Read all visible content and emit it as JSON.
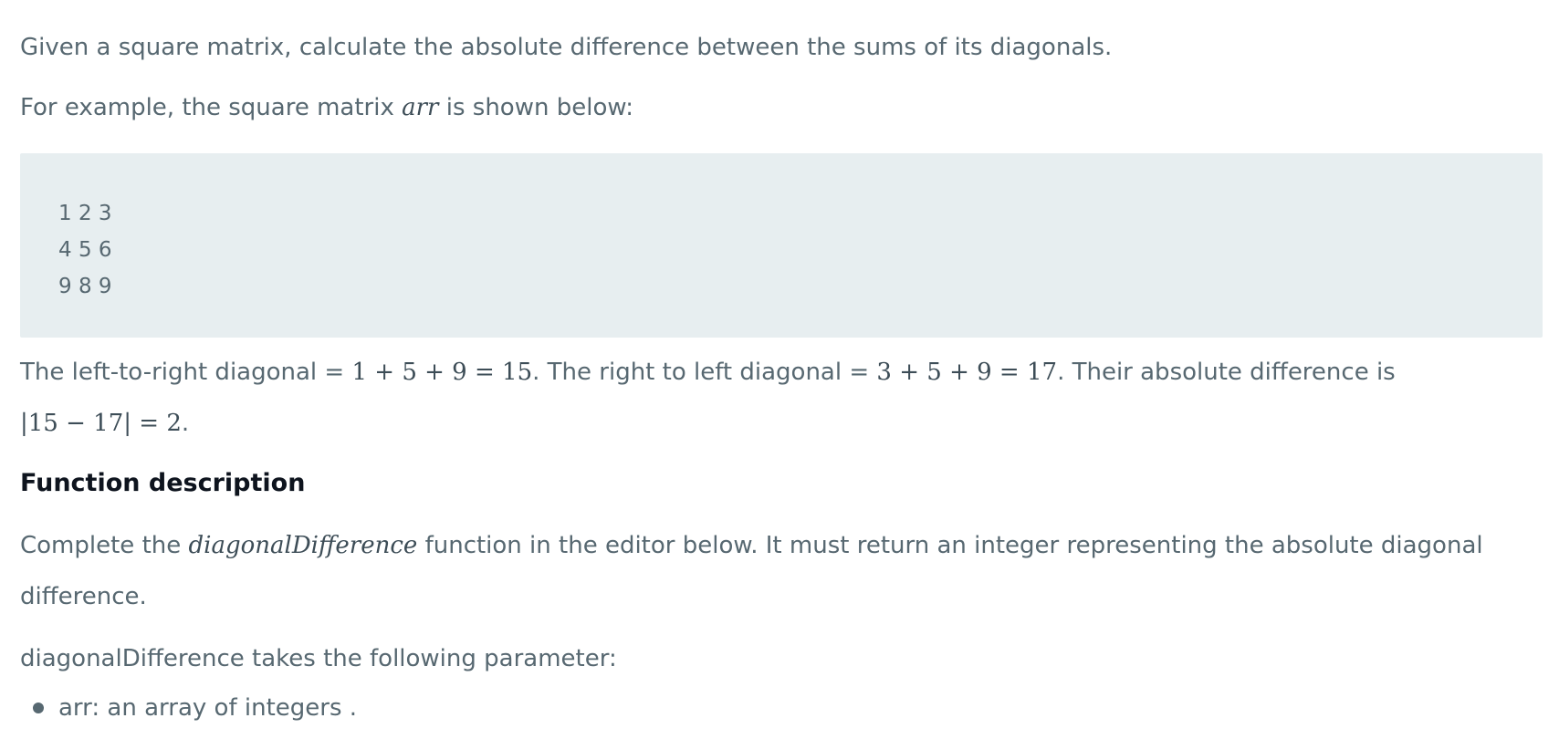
{
  "intro": "Given a square matrix, calculate the absolute difference between the sums of its diagonals.",
  "example": {
    "prefix": "For example, the square matrix ",
    "var": "arr",
    "suffix": " is shown below:"
  },
  "matrix_rows": [
    "1 2 3",
    "4 5 6",
    "9 8 9"
  ],
  "explanation": {
    "t1": "The left-to-right diagonal = ",
    "m1": "1 + 5 + 9 = 15",
    "t2": ". The right to left diagonal = ",
    "m2": "3 + 5 + 9 = 17",
    "t3": ". Their absolute difference is ",
    "m3": "|15 − 17| = 2",
    "t4": "."
  },
  "function_heading": "Function description",
  "complete": {
    "prefix": "Complete the ",
    "fn": "diagonalDifference",
    "suffix": " function in the editor below. It must return an integer representing the absolute diagonal difference."
  },
  "takes": "diagonalDifference takes the following parameter:",
  "params": [
    "arr: an array of integers ."
  ]
}
